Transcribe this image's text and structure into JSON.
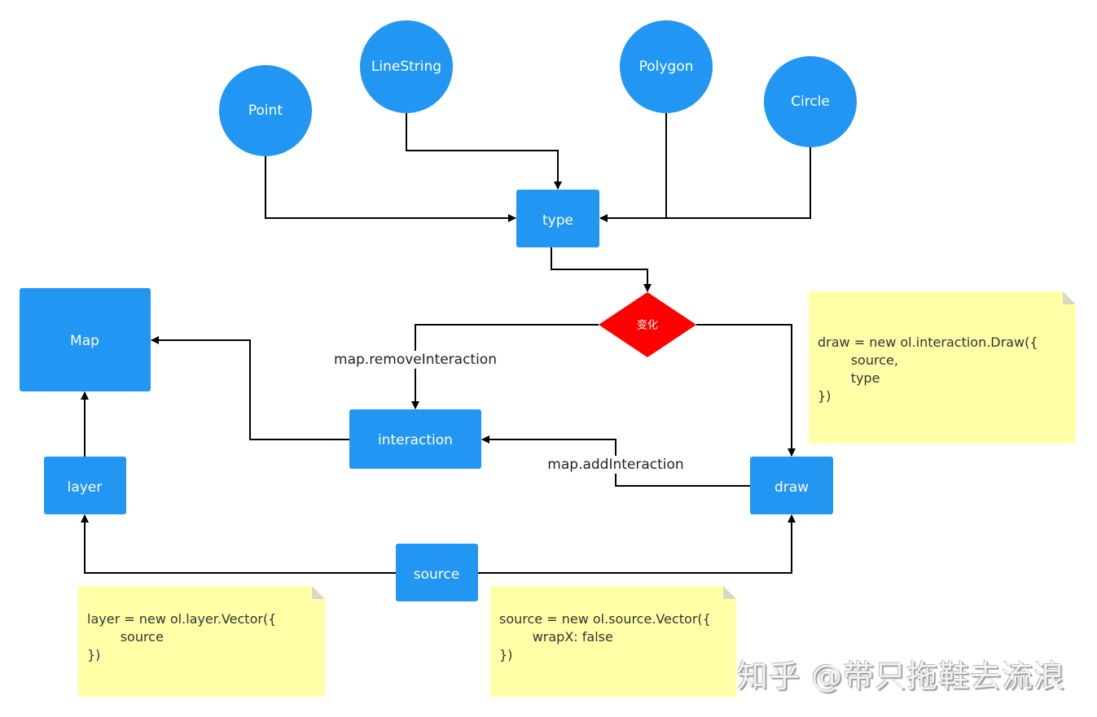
{
  "colors": {
    "node": "#2196f3",
    "decision": "#ff0000",
    "note": "#ffffa8",
    "edge": "#000000"
  },
  "nodes": {
    "point": "Point",
    "linestring": "LineString",
    "polygon": "Polygon",
    "circle": "Circle",
    "type": "type",
    "change": "变化",
    "map": "Map",
    "interaction": "interaction",
    "layer": "layer",
    "draw": "draw",
    "source": "source"
  },
  "edge_labels": {
    "remove": "map.removeInteraction",
    "add": "map.addInteraction"
  },
  "notes": {
    "draw": "draw = new ol.interaction.Draw({\n        source,\n        type\n})",
    "layer": "layer = new ol.layer.Vector({\n        source\n})",
    "source": "source = new ol.source.Vector({\n        wrapX: false\n})"
  },
  "watermark": "知乎 @带只拖鞋去流浪"
}
